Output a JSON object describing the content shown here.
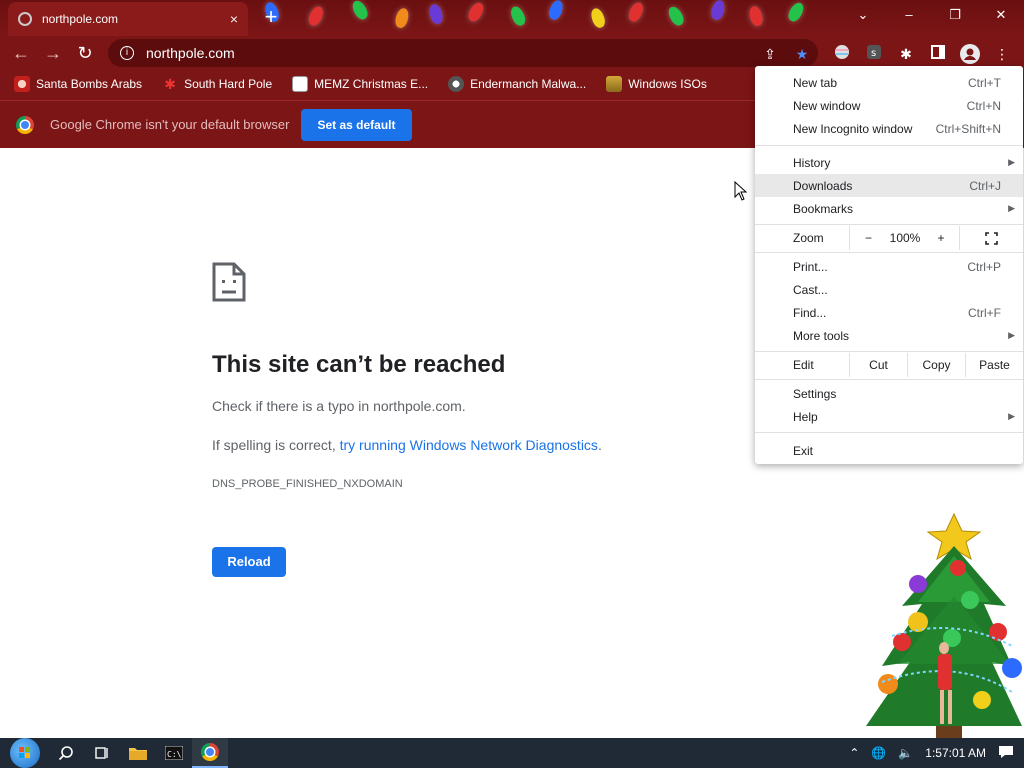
{
  "tab": {
    "title": "northpole.com",
    "close": "×"
  },
  "newtab": "+",
  "window": {
    "minimize": "–",
    "restore": "❐",
    "close": "✕",
    "tabsearch": "⌄"
  },
  "address": {
    "url": "northpole.com"
  },
  "bookmarks": [
    {
      "label": "Santa Bombs Arabs"
    },
    {
      "label": "South Hard Pole"
    },
    {
      "label": "MEMZ Christmas E..."
    },
    {
      "label": "Endermanch Malwa..."
    },
    {
      "label": "Windows ISOs"
    }
  ],
  "infobar": {
    "message": "Google Chrome isn't your default browser",
    "button": "Set as default"
  },
  "error": {
    "title": "This site can’t be reached",
    "line1": "Check if there is a typo in northpole.com.",
    "line2_prefix": "If spelling is correct, ",
    "line2_link": "try running Windows Network Diagnostics",
    "line2_suffix": ".",
    "code": "DNS_PROBE_FINISHED_NXDOMAIN",
    "reload": "Reload"
  },
  "menu": {
    "new_tab": {
      "label": "New tab",
      "shortcut": "Ctrl+T"
    },
    "new_window": {
      "label": "New window",
      "shortcut": "Ctrl+N"
    },
    "incognito": {
      "label": "New Incognito window",
      "shortcut": "Ctrl+Shift+N"
    },
    "history": {
      "label": "History"
    },
    "downloads": {
      "label": "Downloads",
      "shortcut": "Ctrl+J"
    },
    "bookmarks": {
      "label": "Bookmarks"
    },
    "zoom": {
      "label": "Zoom",
      "minus": "−",
      "value": "100%",
      "plus": "+"
    },
    "print": {
      "label": "Print...",
      "shortcut": "Ctrl+P"
    },
    "cast": {
      "label": "Cast..."
    },
    "find": {
      "label": "Find...",
      "shortcut": "Ctrl+F"
    },
    "more_tools": {
      "label": "More tools"
    },
    "edit": {
      "label": "Edit",
      "cut": "Cut",
      "copy": "Copy",
      "paste": "Paste"
    },
    "settings": {
      "label": "Settings"
    },
    "help": {
      "label": "Help"
    },
    "exit": {
      "label": "Exit"
    }
  },
  "taskbar": {
    "clock": "1:57:01 AM"
  },
  "colors": {
    "frame": "#7c1516",
    "accent": "#1a73e8",
    "taskbar": "#1f2a36"
  }
}
